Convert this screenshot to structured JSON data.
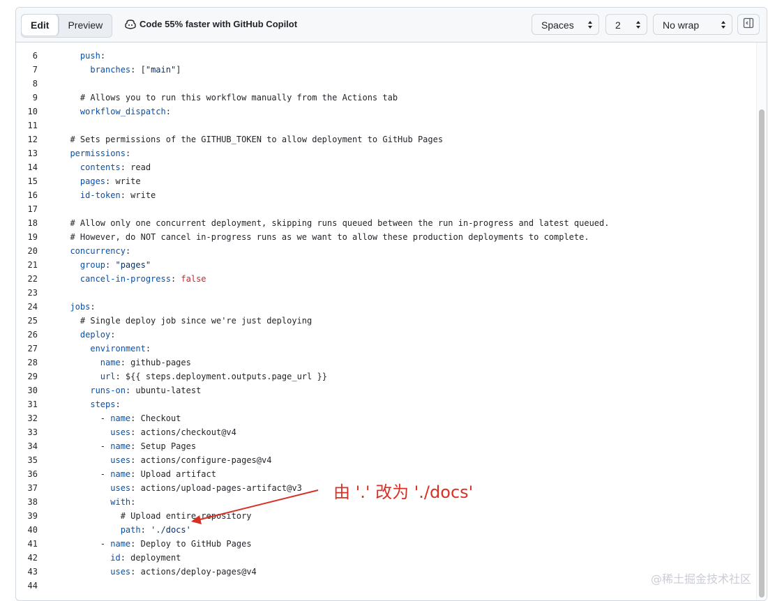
{
  "toolbar": {
    "edit_label": "Edit",
    "preview_label": "Preview",
    "copilot_text": "Code 55% faster with GitHub Copilot",
    "indent_mode": "Spaces",
    "indent_size": "2",
    "wrap_mode": "No wrap"
  },
  "editor": {
    "lines": [
      {
        "n": "6",
        "tokens": [
          {
            "t": "    "
          },
          {
            "t": "push",
            "c": "k"
          },
          {
            "t": ":"
          }
        ]
      },
      {
        "n": "7",
        "tokens": [
          {
            "t": "      "
          },
          {
            "t": "branches",
            "c": "k"
          },
          {
            "t": ": ["
          },
          {
            "t": "\"main\"",
            "c": "s"
          },
          {
            "t": "]"
          }
        ]
      },
      {
        "n": "8",
        "tokens": []
      },
      {
        "n": "9",
        "tokens": [
          {
            "t": "    # Allows you to run this workflow manually from the Actions tab",
            "c": "c"
          }
        ]
      },
      {
        "n": "10",
        "tokens": [
          {
            "t": "    "
          },
          {
            "t": "workflow_dispatch",
            "c": "k"
          },
          {
            "t": ":"
          }
        ]
      },
      {
        "n": "11",
        "tokens": []
      },
      {
        "n": "12",
        "tokens": [
          {
            "t": "  # Sets permissions of the GITHUB_TOKEN to allow deployment to GitHub Pages",
            "c": "c"
          }
        ]
      },
      {
        "n": "13",
        "tokens": [
          {
            "t": "  "
          },
          {
            "t": "permissions",
            "c": "k"
          },
          {
            "t": ":"
          }
        ]
      },
      {
        "n": "14",
        "tokens": [
          {
            "t": "    "
          },
          {
            "t": "contents",
            "c": "k"
          },
          {
            "t": ": read"
          }
        ]
      },
      {
        "n": "15",
        "tokens": [
          {
            "t": "    "
          },
          {
            "t": "pages",
            "c": "k"
          },
          {
            "t": ": write"
          }
        ]
      },
      {
        "n": "16",
        "tokens": [
          {
            "t": "    "
          },
          {
            "t": "id-token",
            "c": "k"
          },
          {
            "t": ": write"
          }
        ]
      },
      {
        "n": "17",
        "tokens": []
      },
      {
        "n": "18",
        "tokens": [
          {
            "t": "  # Allow only one concurrent deployment, skipping runs queued between the run in-progress and latest queued.",
            "c": "c"
          }
        ]
      },
      {
        "n": "19",
        "tokens": [
          {
            "t": "  # However, do NOT cancel in-progress runs as we want to allow these production deployments to complete.",
            "c": "c"
          }
        ]
      },
      {
        "n": "20",
        "tokens": [
          {
            "t": "  "
          },
          {
            "t": "concurrency",
            "c": "k"
          },
          {
            "t": ":"
          }
        ]
      },
      {
        "n": "21",
        "tokens": [
          {
            "t": "    "
          },
          {
            "t": "group",
            "c": "k"
          },
          {
            "t": ": "
          },
          {
            "t": "\"pages\"",
            "c": "s"
          }
        ]
      },
      {
        "n": "22",
        "tokens": [
          {
            "t": "    "
          },
          {
            "t": "cancel-in-progress",
            "c": "k"
          },
          {
            "t": ": "
          },
          {
            "t": "false",
            "c": "b"
          }
        ]
      },
      {
        "n": "23",
        "tokens": []
      },
      {
        "n": "24",
        "tokens": [
          {
            "t": "  "
          },
          {
            "t": "jobs",
            "c": "k"
          },
          {
            "t": ":"
          }
        ]
      },
      {
        "n": "25",
        "tokens": [
          {
            "t": "    # Single deploy job since we're just deploying",
            "c": "c"
          }
        ]
      },
      {
        "n": "26",
        "tokens": [
          {
            "t": "    "
          },
          {
            "t": "deploy",
            "c": "k"
          },
          {
            "t": ":"
          }
        ]
      },
      {
        "n": "27",
        "tokens": [
          {
            "t": "      "
          },
          {
            "t": "environment",
            "c": "k"
          },
          {
            "t": ":"
          }
        ]
      },
      {
        "n": "28",
        "tokens": [
          {
            "t": "        "
          },
          {
            "t": "name",
            "c": "k"
          },
          {
            "t": ": github-pages"
          }
        ]
      },
      {
        "n": "29",
        "tokens": [
          {
            "t": "        "
          },
          {
            "t": "url",
            "c": "k"
          },
          {
            "t": ": ${{ steps.deployment.outputs.page_url }}"
          }
        ]
      },
      {
        "n": "30",
        "tokens": [
          {
            "t": "      "
          },
          {
            "t": "runs-on",
            "c": "k"
          },
          {
            "t": ": ubuntu-latest"
          }
        ]
      },
      {
        "n": "31",
        "tokens": [
          {
            "t": "      "
          },
          {
            "t": "steps",
            "c": "k"
          },
          {
            "t": ":"
          }
        ]
      },
      {
        "n": "32",
        "tokens": [
          {
            "t": "        - "
          },
          {
            "t": "name",
            "c": "k"
          },
          {
            "t": ": Checkout"
          }
        ]
      },
      {
        "n": "33",
        "tokens": [
          {
            "t": "          "
          },
          {
            "t": "uses",
            "c": "k"
          },
          {
            "t": ": actions/checkout@v4"
          }
        ]
      },
      {
        "n": "34",
        "tokens": [
          {
            "t": "        - "
          },
          {
            "t": "name",
            "c": "k"
          },
          {
            "t": ": Setup Pages"
          }
        ]
      },
      {
        "n": "35",
        "tokens": [
          {
            "t": "          "
          },
          {
            "t": "uses",
            "c": "k"
          },
          {
            "t": ": actions/configure-pages@v4"
          }
        ]
      },
      {
        "n": "36",
        "tokens": [
          {
            "t": "        - "
          },
          {
            "t": "name",
            "c": "k"
          },
          {
            "t": ": Upload artifact"
          }
        ]
      },
      {
        "n": "37",
        "tokens": [
          {
            "t": "          "
          },
          {
            "t": "uses",
            "c": "k"
          },
          {
            "t": ": actions/upload-pages-artifact@v3"
          }
        ]
      },
      {
        "n": "38",
        "tokens": [
          {
            "t": "          "
          },
          {
            "t": "with",
            "c": "k"
          },
          {
            "t": ":"
          }
        ]
      },
      {
        "n": "39",
        "tokens": [
          {
            "t": "            # Upload entire repository",
            "c": "c"
          }
        ]
      },
      {
        "n": "40",
        "tokens": [
          {
            "t": "            "
          },
          {
            "t": "path",
            "c": "k"
          },
          {
            "t": ": "
          },
          {
            "t": "'./docs'",
            "c": "s"
          }
        ]
      },
      {
        "n": "41",
        "tokens": [
          {
            "t": "        - "
          },
          {
            "t": "name",
            "c": "k"
          },
          {
            "t": ": Deploy to GitHub Pages"
          }
        ]
      },
      {
        "n": "42",
        "tokens": [
          {
            "t": "          "
          },
          {
            "t": "id",
            "c": "k"
          },
          {
            "t": ": deployment"
          }
        ]
      },
      {
        "n": "43",
        "tokens": [
          {
            "t": "          "
          },
          {
            "t": "uses",
            "c": "k"
          },
          {
            "t": ": actions/deploy-pages@v4"
          }
        ]
      },
      {
        "n": "44",
        "tokens": []
      }
    ]
  },
  "annotation": {
    "text": "由 '.' 改为 './docs'",
    "color": "#d93025"
  },
  "watermark": "@稀土掘金技术社区",
  "colors": {
    "key": "#0550ae",
    "string": "#0a3069",
    "boolean": "#cf222e"
  },
  "icons": {
    "copilot": "copilot-icon",
    "side_panel": "sidebar-toggle-icon"
  }
}
